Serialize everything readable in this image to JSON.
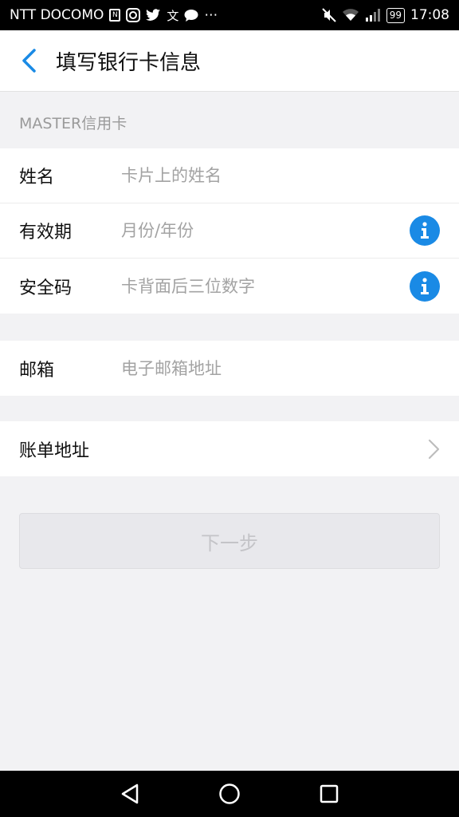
{
  "status_bar": {
    "carrier": "NTT DOCOMO",
    "battery": "99",
    "time": "17:08",
    "icons": [
      "n-icon",
      "camera-icon",
      "twitter-icon",
      "translate-icon",
      "chat-bubble-icon",
      "more-dots-icon",
      "mute-icon",
      "wifi-icon",
      "signal-icon"
    ]
  },
  "header": {
    "title": "填写银行卡信息",
    "back_icon": "chevron-left-icon"
  },
  "card_section": {
    "label": "MASTER信用卡",
    "fields": [
      {
        "label": "姓名",
        "placeholder": "卡片上的姓名",
        "value": "",
        "has_info": false
      },
      {
        "label": "有效期",
        "placeholder": "月份/年份",
        "value": "",
        "has_info": true
      },
      {
        "label": "安全码",
        "placeholder": "卡背面后三位数字",
        "value": "",
        "has_info": true
      }
    ]
  },
  "email_section": {
    "label": "邮箱",
    "placeholder": "电子邮箱地址",
    "value": ""
  },
  "billing_section": {
    "label": "账单地址"
  },
  "next_button": {
    "label": "下一步"
  },
  "colors": {
    "accent": "#1a8ae5",
    "background": "#f2f2f4",
    "disabled_button": "#e8e8ec",
    "disabled_text": "#c4c4c8"
  }
}
